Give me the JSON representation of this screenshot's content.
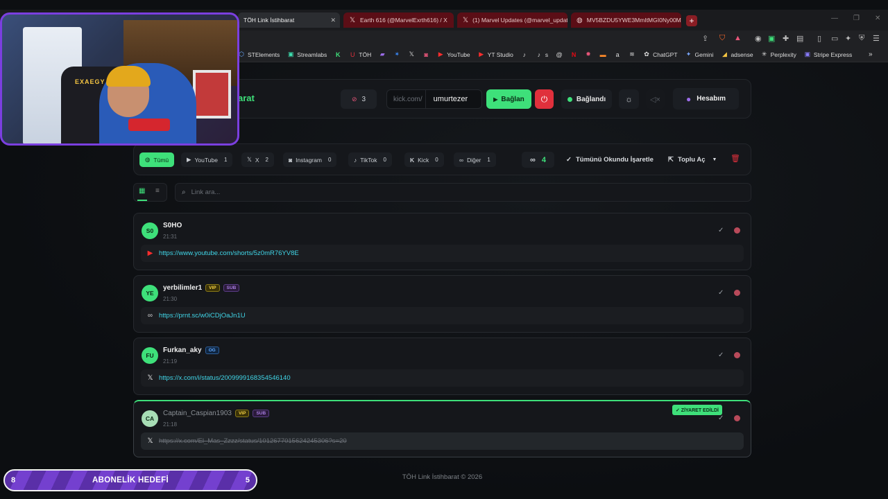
{
  "browser": {
    "tabs": [
      {
        "title": "TÖH Link İstihbarat",
        "icon": "globe-icon",
        "active": true
      },
      {
        "title": "Earth 616 (@MarvelExrth616) / X",
        "icon": "x-icon"
      },
      {
        "title": "(1) Marvel Updates (@marvel_updat",
        "icon": "x-icon"
      },
      {
        "title": "MV5BZDU5YWE3MmItMGI0Ny00MW",
        "icon": "globe-icon"
      }
    ],
    "bookmarks": [
      {
        "label": "STElements",
        "icon": "st-icon"
      },
      {
        "label": "Streamlabs",
        "icon": "streamlabs-icon"
      },
      {
        "label": "",
        "icon": "kick-icon"
      },
      {
        "label": "TÖH",
        "icon": "toh-icon"
      },
      {
        "label": "",
        "icon": "twitch-icon"
      },
      {
        "label": "",
        "icon": "bluesky-icon"
      },
      {
        "label": "",
        "icon": "x-icon"
      },
      {
        "label": "",
        "icon": "instagram-icon"
      },
      {
        "label": "YouTube",
        "icon": "youtube-icon"
      },
      {
        "label": "YT Studio",
        "icon": "yt-studio-icon"
      },
      {
        "label": "",
        "icon": "tiktok-icon"
      },
      {
        "label": "s",
        "icon": "tiktok-icon"
      },
      {
        "label": "",
        "icon": "threads-icon"
      },
      {
        "label": "",
        "icon": "netflix-icon"
      },
      {
        "label": "",
        "icon": "bookmark-icon"
      },
      {
        "label": "",
        "icon": "bookmark-icon"
      },
      {
        "label": "",
        "icon": "amazon-icon"
      },
      {
        "label": "",
        "icon": "bookmark-icon"
      },
      {
        "label": "ChatGPT",
        "icon": "chatgpt-icon"
      },
      {
        "label": "Gemini",
        "icon": "gemini-icon"
      },
      {
        "label": "adsense",
        "icon": "adsense-icon"
      },
      {
        "label": "Perplexity",
        "icon": "perplexity-icon"
      },
      {
        "label": "Stripe Express",
        "icon": "stripe-icon"
      }
    ]
  },
  "header": {
    "brand": "arat",
    "ban_count": "3",
    "kick_prefix": "kick.com/",
    "kick_user": "umurtezer",
    "connect_label": "Bağlan",
    "status_label": "Bağlandı",
    "account_label": "Hesabım",
    "colors": {
      "accent": "#3ee07a",
      "danger": "#e0303c",
      "account_icon": "#9b6ce8"
    }
  },
  "filters": {
    "chips": [
      {
        "label": "Tümü",
        "count": "",
        "icon": "globe-icon",
        "active": true
      },
      {
        "label": "YouTube",
        "count": "1",
        "icon": "youtube-icon"
      },
      {
        "label": "X",
        "count": "2",
        "icon": "x-icon"
      },
      {
        "label": "Instagram",
        "count": "0",
        "icon": "instagram-icon"
      },
      {
        "label": "TikTok",
        "count": "0",
        "icon": "tiktok-icon"
      },
      {
        "label": "Kick",
        "count": "0",
        "icon": "kick-icon"
      },
      {
        "label": "Diğer",
        "count": "1",
        "icon": "link-icon"
      }
    ],
    "link_count": "4",
    "mark_all_read": "Tümünü Okundu İşaretle",
    "bulk_open": "Toplu Aç"
  },
  "search": {
    "placeholder": "Link ara..."
  },
  "messages": [
    {
      "initials": "S0",
      "user": "S0HO",
      "badges": [],
      "time": "21:31",
      "url": "https://www.youtube.com/shorts/5z0mR76YV8E",
      "platform": "youtube-icon",
      "visited": false
    },
    {
      "initials": "YE",
      "user": "yerbilimler1",
      "badges": [
        "VIP",
        "SUB"
      ],
      "time": "21:30",
      "url": "https://prnt.sc/w0iCDjOaJn1U",
      "platform": "link-icon",
      "visited": false
    },
    {
      "initials": "FU",
      "user": "Furkan_aky",
      "badges": [
        "OG"
      ],
      "time": "21:19",
      "url": "https://x.com/i/status/2009999168354546140",
      "platform": "x-icon",
      "visited": false
    },
    {
      "initials": "CA",
      "user": "Captain_Caspian1903",
      "badges": [
        "VIP",
        "SUB"
      ],
      "time": "21:18",
      "url": "https://x.com/El_Mas_Zzzz/status/1012677015624245306?s=20",
      "platform": "x-icon",
      "visited": true,
      "visited_label": "✓ ZİYARET EDİLDİ"
    }
  ],
  "footer": "TÖH Link İstihbarat © 2026",
  "stream_overlay": {
    "goal_title": "ABONELİK HEDEFİ",
    "goal_current": "8",
    "goal_target": "5",
    "webcam_chair_text": "EXAEGY"
  }
}
